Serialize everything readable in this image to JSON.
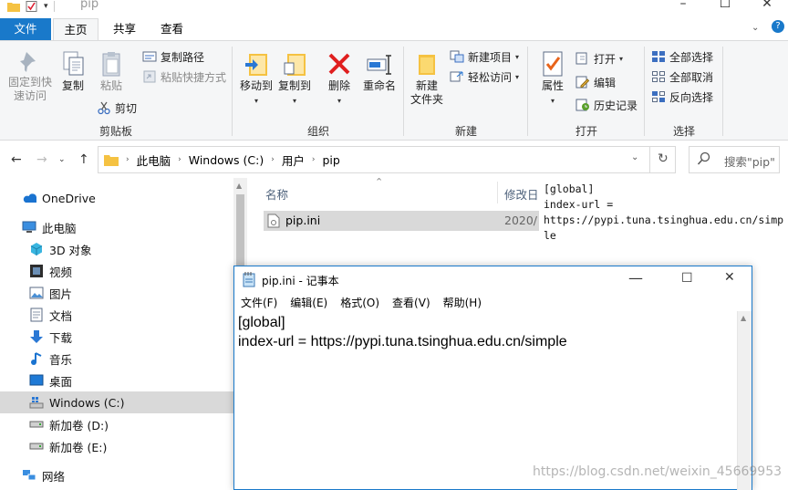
{
  "explorer": {
    "title": "pip",
    "tabs": {
      "file": "文件",
      "home": "主页",
      "share": "共享",
      "view": "查看"
    },
    "ribbon": {
      "clipboard": {
        "group_label": "剪贴板",
        "pin_line1": "固定到快",
        "pin_line2": "速访问",
        "copy": "复制",
        "paste": "粘贴",
        "copy_path": "复制路径",
        "paste_shortcut": "粘贴快捷方式",
        "cut": "剪切"
      },
      "organize": {
        "group_label": "组织",
        "move_to": "移动到",
        "copy_to": "复制到",
        "delete": "删除",
        "rename": "重命名"
      },
      "new": {
        "group_label": "新建",
        "new_folder_line1": "新建",
        "new_folder_line2": "文件夹",
        "new_item": "新建项目",
        "easy_access": "轻松访问"
      },
      "open": {
        "group_label": "打开",
        "properties": "属性",
        "open": "打开",
        "edit": "编辑",
        "history": "历史记录"
      },
      "select": {
        "group_label": "选择",
        "select_all": "全部选择",
        "select_none": "全部取消",
        "invert": "反向选择"
      }
    },
    "address": {
      "crumbs": [
        "此电脑",
        "Windows (C:)",
        "用户",
        "pip"
      ]
    },
    "search_placeholder": "搜索\"pip\"",
    "nav": {
      "onedrive": "OneDrive",
      "this_pc": "此电脑",
      "objects3d": "3D 对象",
      "videos": "视频",
      "pictures": "图片",
      "documents": "文档",
      "downloads": "下载",
      "music": "音乐",
      "desktop": "桌面",
      "drive_c": "Windows (C:)",
      "drive_d": "新加卷 (D:)",
      "drive_e": "新加卷 (E:)",
      "network": "网络"
    },
    "columns": {
      "name": "名称",
      "modified": "修改日"
    },
    "files": [
      {
        "name": "pip.ini",
        "modified": "2020/"
      }
    ],
    "preview_lines": [
      "[global]",
      "index-url =",
      "https://pypi.tuna.tsinghua.edu.cn/simp",
      "le"
    ]
  },
  "notepad": {
    "title": "pip.ini - 记事本",
    "menu": [
      "文件(F)",
      "编辑(E)",
      "格式(O)",
      "查看(V)",
      "帮助(H)"
    ],
    "lines": [
      "[global]",
      "index-url = https://pypi.tuna.tsinghua.edu.cn/simple"
    ]
  },
  "watermark": "https://blog.csdn.net/weixin_45669953",
  "colors": {
    "accent": "#1979ca",
    "selection": "#d9d9d9",
    "ribbon_bg": "#f5f6f7",
    "delete_red": "#e01f1f",
    "folder_yellow": "#f5c242"
  }
}
